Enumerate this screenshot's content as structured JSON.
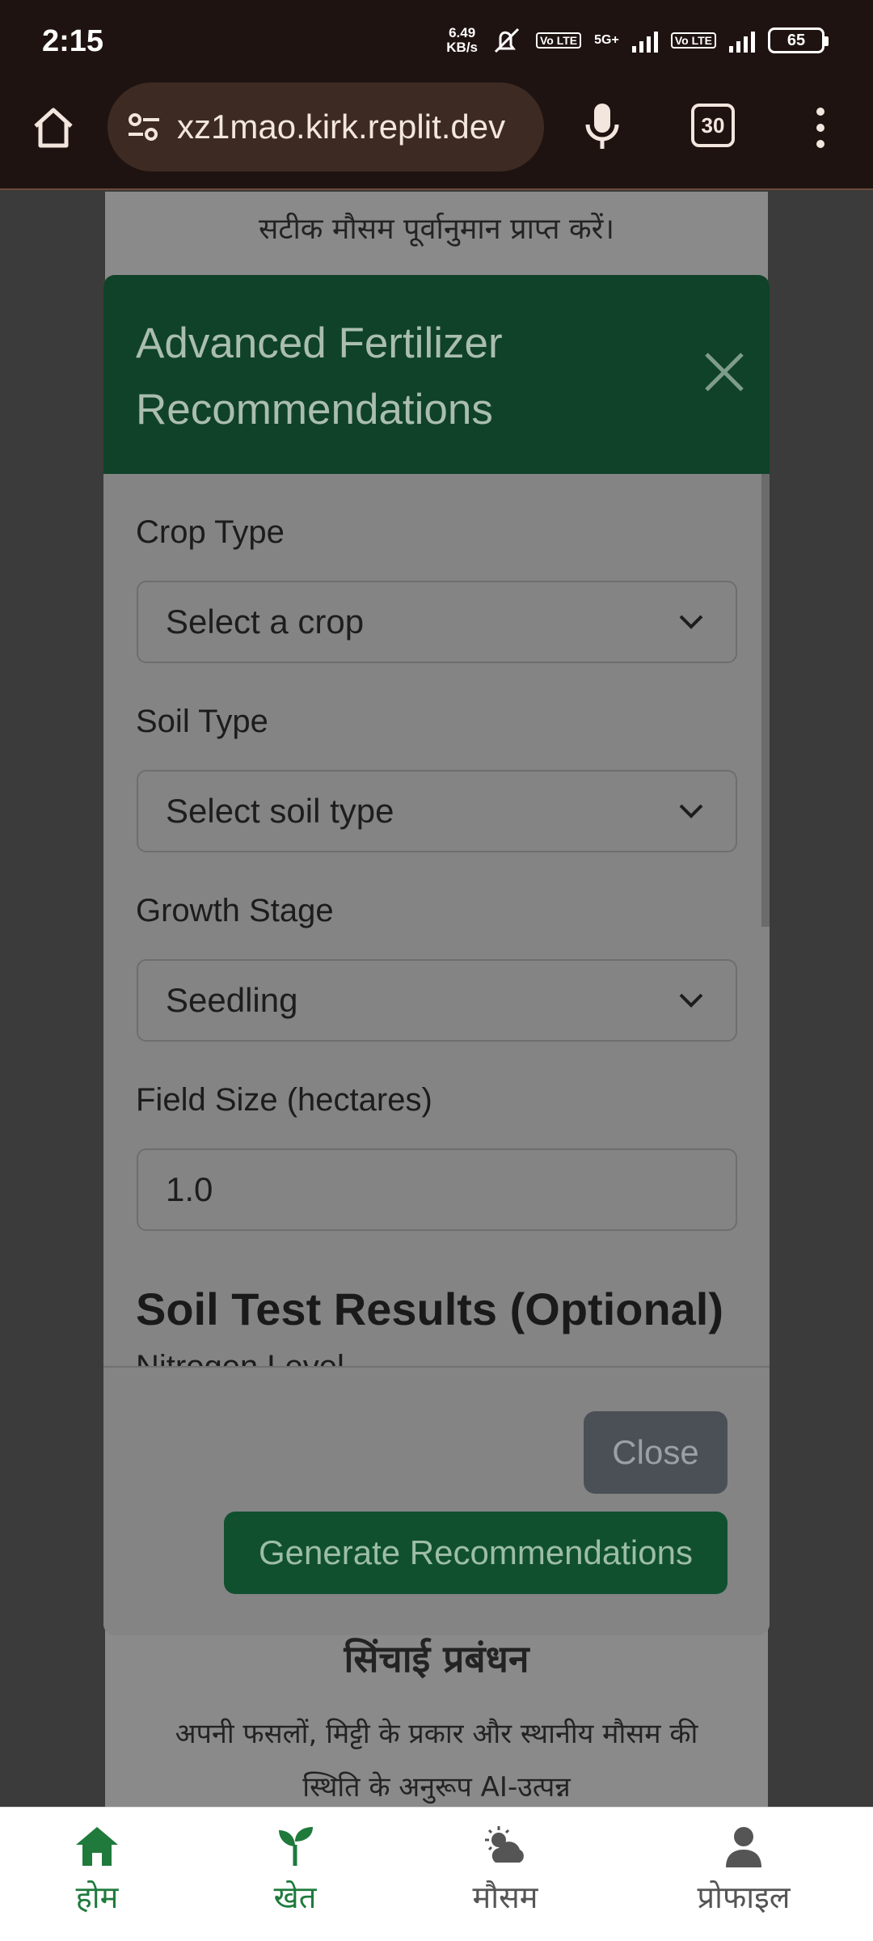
{
  "status_bar": {
    "time": "2:15",
    "net_speed_value": "6.49",
    "net_speed_unit": "KB/s",
    "sim1_badge": "Vo LTE",
    "network_type": "5G+",
    "sim2_badge": "Vo LTE",
    "battery": "65"
  },
  "browser": {
    "url": "xz1mao.kirk.replit.dev",
    "tab_count": "30"
  },
  "background_page": {
    "top_text": "सटीक मौसम पूर्वानुमान प्राप्त करें।",
    "section_heading": "सिंचाई प्रबंधन",
    "section_text": "अपनी फसलों, मिट्टी के प्रकार और स्थानीय मौसम की स्थिति के अनुरूप AI-उत्पन्न"
  },
  "modal": {
    "title": "Advanced Fertilizer Recommendations",
    "fields": {
      "crop_type_label": "Crop Type",
      "crop_type_value": "Select a crop",
      "soil_type_label": "Soil Type",
      "soil_type_value": "Select soil type",
      "growth_stage_label": "Growth Stage",
      "growth_stage_value": "Seedling",
      "field_size_label": "Field Size (hectares)",
      "field_size_value": "1.0"
    },
    "soil_test_heading": "Soil Test Results (Optional)",
    "nitrogen_label": "Nitrogen Level",
    "close_button": "Close",
    "generate_button": "Generate Recommendations"
  },
  "bottom_nav": {
    "home": "होम",
    "field": "खेत",
    "weather": "मौसम",
    "profile": "प्रोफाइल"
  },
  "colors": {
    "modal_header": "#0f4229",
    "primary_button": "#10502f",
    "secondary_button": "#4b5056",
    "nav_active": "#1f7a3c"
  }
}
